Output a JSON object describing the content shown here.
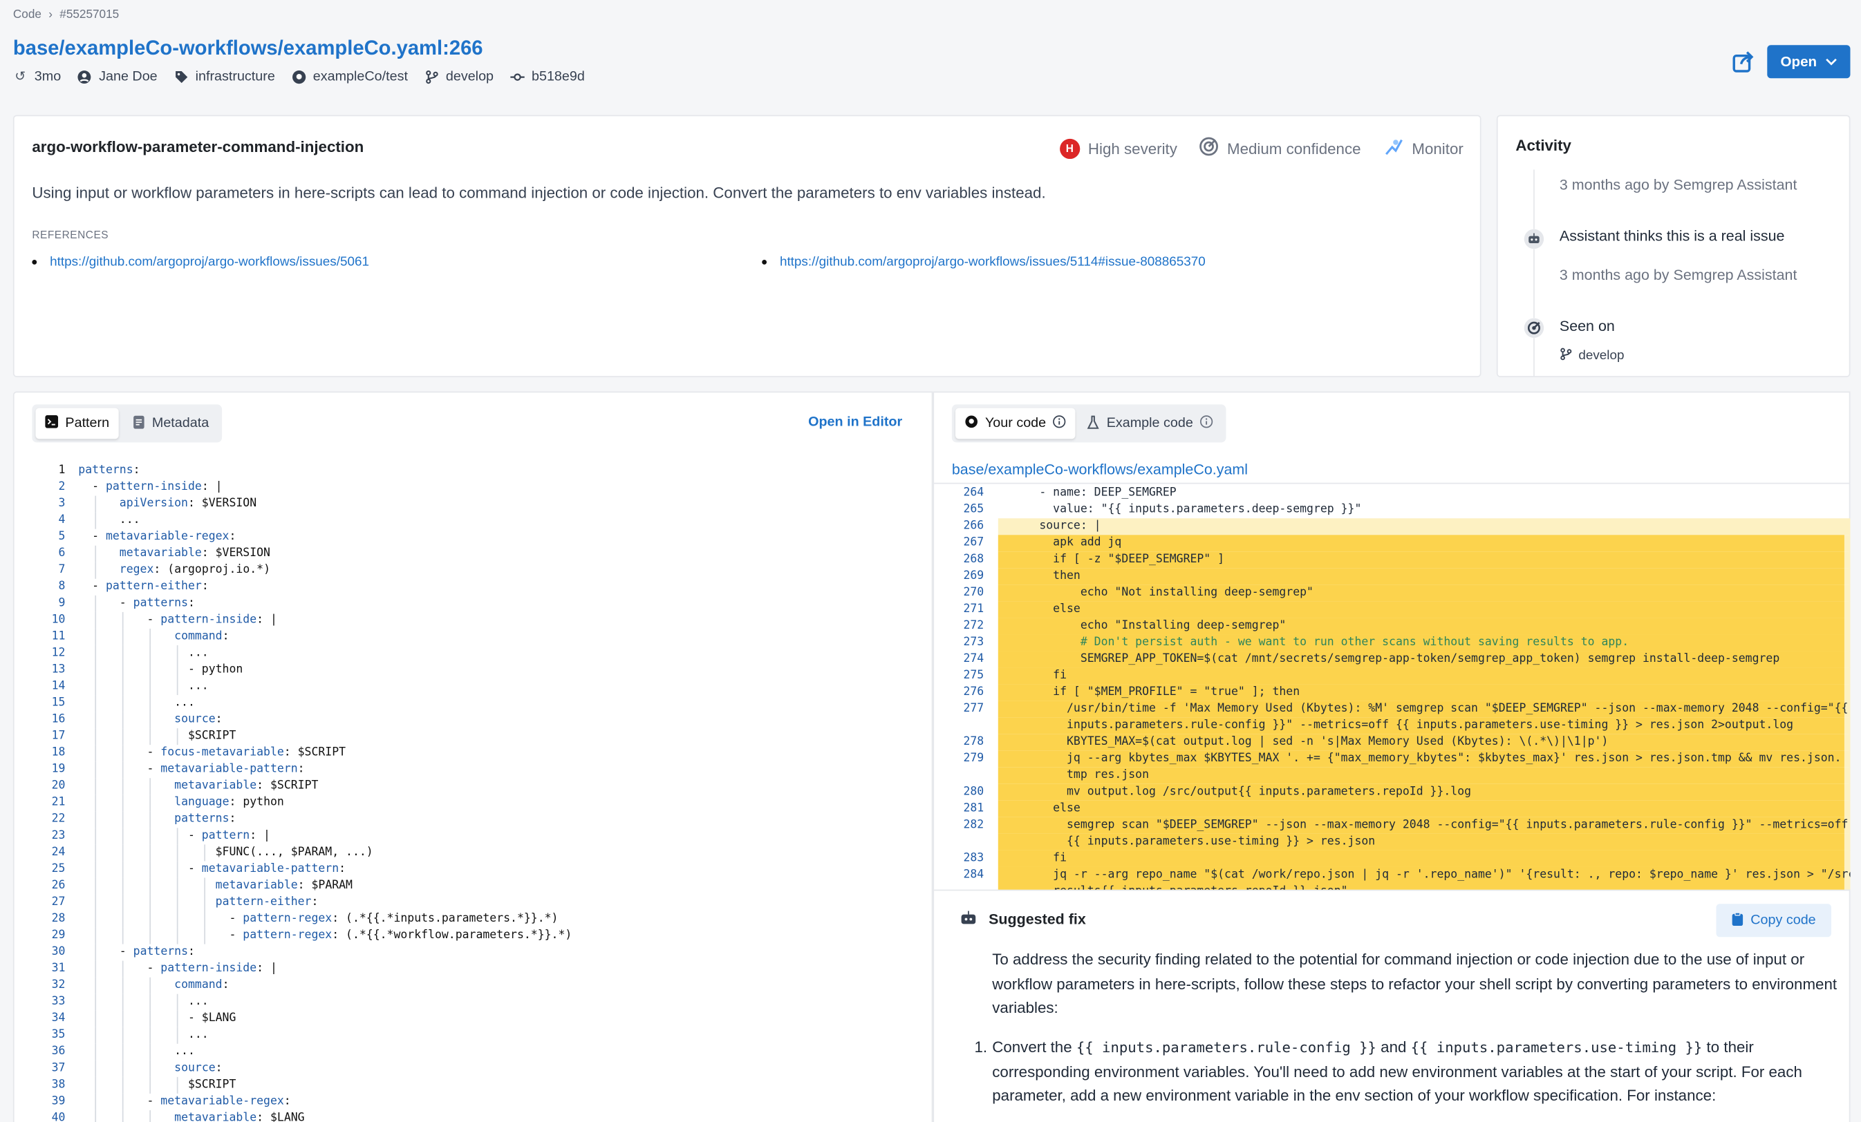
{
  "breadcrumb": {
    "root": "Code",
    "id": "#55257015"
  },
  "title": "base/exampleCo-workflows/exampleCo.yaml:266",
  "meta": {
    "age": "3mo",
    "author": "Jane Doe",
    "tag": "infrastructure",
    "repo": "exampleCo/test",
    "branch": "develop",
    "commit": "b518e9d"
  },
  "open_button": "Open",
  "finding": {
    "rule": "argo-workflow-parameter-command-injection",
    "severity": "High severity",
    "severity_letter": "H",
    "confidence": "Medium confidence",
    "mode": "Monitor",
    "description": "Using input or workflow parameters in here-scripts can lead to command injection or code injection. Convert the parameters to env variables instead.",
    "references_label": "REFERENCES",
    "references": [
      "https://github.com/argoproj/argo-workflows/issues/5061",
      "https://github.com/argoproj/argo-workflows/issues/5114#issue-808865370"
    ]
  },
  "activity": {
    "title": "Activity",
    "entry1": "3 months ago by Semgrep Assistant",
    "entry2_title": "Assistant thinks this is a real issue",
    "entry2_time": "3 months ago by Semgrep Assistant",
    "entry3_title": "Seen on",
    "entry3_branch": "develop"
  },
  "pattern_panel": {
    "tabs": [
      "Pattern",
      "Metadata"
    ],
    "open_in_editor": "Open in Editor",
    "lines": [
      "patterns:",
      "  - pattern-inside: |",
      "      apiVersion: $VERSION",
      "      ...",
      "  - metavariable-regex:",
      "      metavariable: $VERSION",
      "      regex: (argoproj.io.*)",
      "  - pattern-either:",
      "      - patterns:",
      "          - pattern-inside: |",
      "              command:",
      "                ...",
      "                - python",
      "                ...",
      "              ...",
      "              source:",
      "                $SCRIPT",
      "          - focus-metavariable: $SCRIPT",
      "          - metavariable-pattern:",
      "              metavariable: $SCRIPT",
      "              language: python",
      "              patterns:",
      "                - pattern: |",
      "                    $FUNC(..., $PARAM, ...)",
      "                - metavariable-pattern:",
      "                    metavariable: $PARAM",
      "                    pattern-either:",
      "                      - pattern-regex: (.*{{.*inputs.parameters.*}}.*)",
      "                      - pattern-regex: (.*{{.*workflow.parameters.*}}.*)",
      "      - patterns:",
      "          - pattern-inside: |",
      "              command:",
      "                ...",
      "                - $LANG",
      "                ...",
      "              ...",
      "              source:",
      "                $SCRIPT",
      "          - metavariable-regex:",
      "              metavariable: $LANG"
    ]
  },
  "code_panel": {
    "tabs": [
      "Your code",
      "Example code"
    ],
    "file_path": "base/exampleCo-workflows/exampleCo.yaml",
    "lines": [
      {
        "n": "264",
        "t": "      - name: DEEP_SEMGREP",
        "h": 0
      },
      {
        "n": "265",
        "t": "        value: \"{{ inputs.parameters.deep-semgrep }}\"",
        "h": 0
      },
      {
        "n": "266",
        "t": "      source: |",
        "h": 1
      },
      {
        "n": "267",
        "t": "        apk add jq",
        "h": 2
      },
      {
        "n": "268",
        "t": "        if [ -z \"$DEEP_SEMGREP\" ]",
        "h": 2
      },
      {
        "n": "269",
        "t": "        then",
        "h": 2
      },
      {
        "n": "270",
        "t": "            echo \"Not installing deep-semgrep\"",
        "h": 2
      },
      {
        "n": "271",
        "t": "        else",
        "h": 2
      },
      {
        "n": "272",
        "t": "            echo \"Installing deep-semgrep\"",
        "h": 2
      },
      {
        "n": "273",
        "t": "            # Don't persist auth - we want to run other scans without saving results to app.",
        "h": 2,
        "c": 1
      },
      {
        "n": "274",
        "t": "            SEMGREP_APP_TOKEN=$(cat /mnt/secrets/semgrep-app-token/semgrep_app_token) semgrep install-deep-semgrep",
        "h": 2
      },
      {
        "n": "275",
        "t": "        fi",
        "h": 2
      },
      {
        "n": "276",
        "t": "        if [ \"$MEM_PROFILE\" = \"true\" ]; then",
        "h": 2
      },
      {
        "n": "277",
        "t": "          /usr/bin/time -f 'Max Memory Used (Kbytes): %M' semgrep scan \"$DEEP_SEMGREP\" --json --max-memory 2048 --config=\"{{",
        "h": 2
      },
      {
        "n": "",
        "t": "          inputs.parameters.rule-config }}\" --metrics=off {{ inputs.parameters.use-timing }} > res.json 2>output.log",
        "h": 2
      },
      {
        "n": "278",
        "t": "          KBYTES_MAX=$(cat output.log | sed -n 's|Max Memory Used (Kbytes): \\(.*\\)|\\1|p')",
        "h": 2
      },
      {
        "n": "279",
        "t": "          jq --arg kbytes_max $KBYTES_MAX '. += {\"max_memory_kbytes\": $kbytes_max}' res.json > res.json.tmp && mv res.json.",
        "h": 2
      },
      {
        "n": "",
        "t": "          tmp res.json",
        "h": 2
      },
      {
        "n": "280",
        "t": "          mv output.log /src/output{{ inputs.parameters.repoId }}.log",
        "h": 2
      },
      {
        "n": "281",
        "t": "        else",
        "h": 2
      },
      {
        "n": "282",
        "t": "          semgrep scan \"$DEEP_SEMGREP\" --json --max-memory 2048 --config=\"{{ inputs.parameters.rule-config }}\" --metrics=off",
        "h": 2
      },
      {
        "n": "",
        "t": "          {{ inputs.parameters.use-timing }} > res.json",
        "h": 2
      },
      {
        "n": "283",
        "t": "        fi",
        "h": 2
      },
      {
        "n": "284",
        "t": "        jq -r --arg repo_name \"$(cat /work/repo.json | jq -r '.repo_name')\" '{result: ., repo: $repo_name }' res.json > \"/src/",
        "h": 2
      },
      {
        "n": "",
        "t": "        results{{ inputs.parameters.repoId }}.json\"",
        "h": 2
      }
    ],
    "fix_title": "Suggested fix",
    "copy_label": "Copy code",
    "fix_intro": "To address the security finding related to the potential for command injection or code injection due to the use of input or workflow parameters in here-scripts, follow these steps to refactor your shell script by converting parameters to environment variables:",
    "fix_item_num": "1.",
    "fix_item_a": "Convert the ",
    "fix_code1": "{{ inputs.parameters.rule-config }}",
    "fix_item_b": " and ",
    "fix_code2": "{{ inputs.parameters.use-timing }}",
    "fix_item_c": " to their corresponding environment variables. You'll need to add new environment variables at the start of your script. For each parameter, add a new environment variable in the env section of your workflow specification. For instance:"
  },
  "colors": {
    "accent": "#1f73c9",
    "highlight": "#fcd34d",
    "highlight_soft": "#fdf1c2",
    "severity_high": "#dc2626"
  }
}
